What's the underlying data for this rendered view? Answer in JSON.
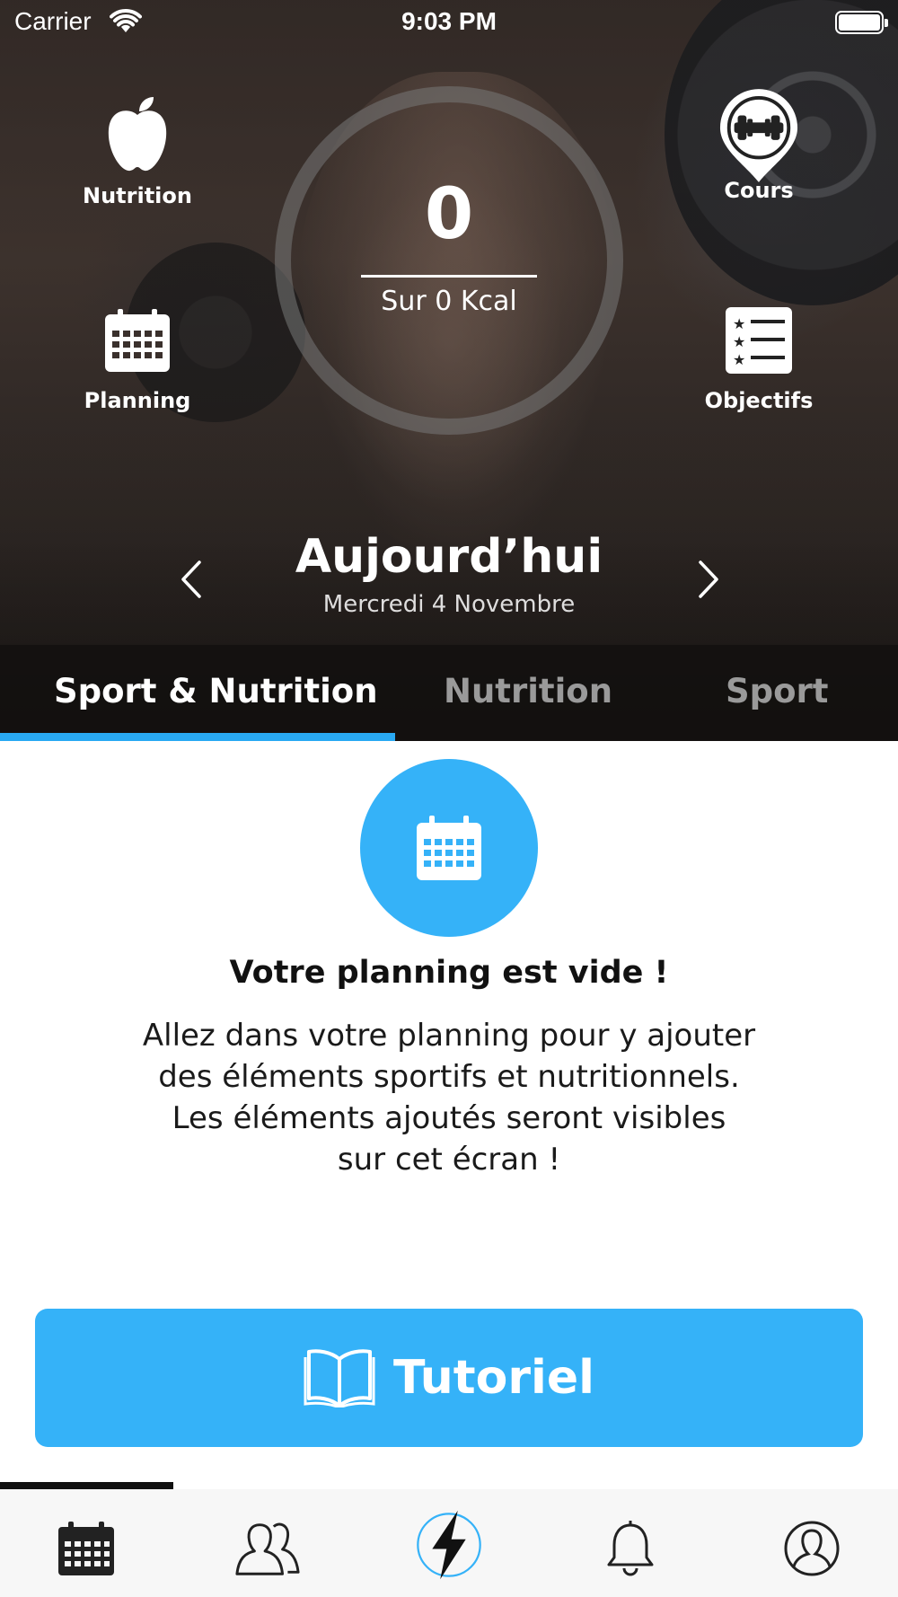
{
  "status_bar": {
    "carrier": "Carrier",
    "time": "9:03 PM"
  },
  "quick_actions": {
    "nutrition": "Nutrition",
    "courses": "Cours",
    "planning": "Planning",
    "goals": "Objectifs"
  },
  "calories": {
    "value": "0",
    "goal_text": "Sur 0 Kcal"
  },
  "date_nav": {
    "title": "Aujourd’hui",
    "subtitle": "Mercredi 4 Novembre"
  },
  "tabs": [
    {
      "label": "Sport & Nutrition",
      "active": true
    },
    {
      "label": "Nutrition",
      "active": false
    },
    {
      "label": "Sport",
      "active": false
    }
  ],
  "empty_state": {
    "title": "Votre planning est vide !",
    "line1": "Allez dans votre planning pour y ajouter",
    "line2": "des éléments sportifs et nutritionnels.",
    "line3": "Les éléments ajoutés seront visibles",
    "line4": "sur cet écran !"
  },
  "tutorial_button": {
    "label": "Tutoriel"
  },
  "bottom_nav": {
    "items": [
      "calendar-icon",
      "group-icon",
      "lightning-icon",
      "bell-icon",
      "profile-icon"
    ],
    "active_index": 0
  },
  "colors": {
    "accent": "#35b2f8",
    "tab_underline": "#29a9f3",
    "tab_inactive": "#9a9a9a"
  }
}
